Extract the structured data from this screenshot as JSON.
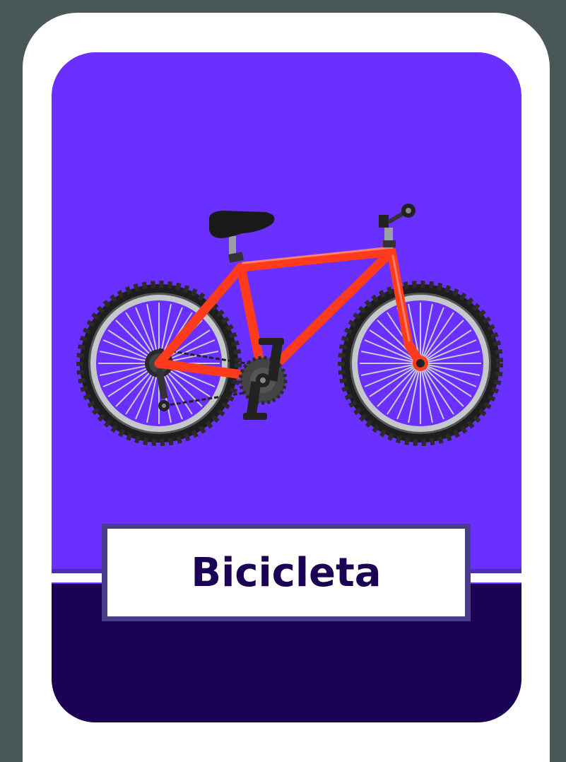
{
  "card": {
    "word": "Bicicleta",
    "image_icon": "bicycle-icon"
  },
  "colors": {
    "outer_background": "#4a5758",
    "card_border": "#ffffff",
    "panel_top": "#6a30ff",
    "panel_bottom": "#1b0255",
    "frame": "#ff3b1d",
    "tire": "#1a1a1a",
    "rim": "#9aa0a6",
    "label_text": "#1b0255"
  }
}
